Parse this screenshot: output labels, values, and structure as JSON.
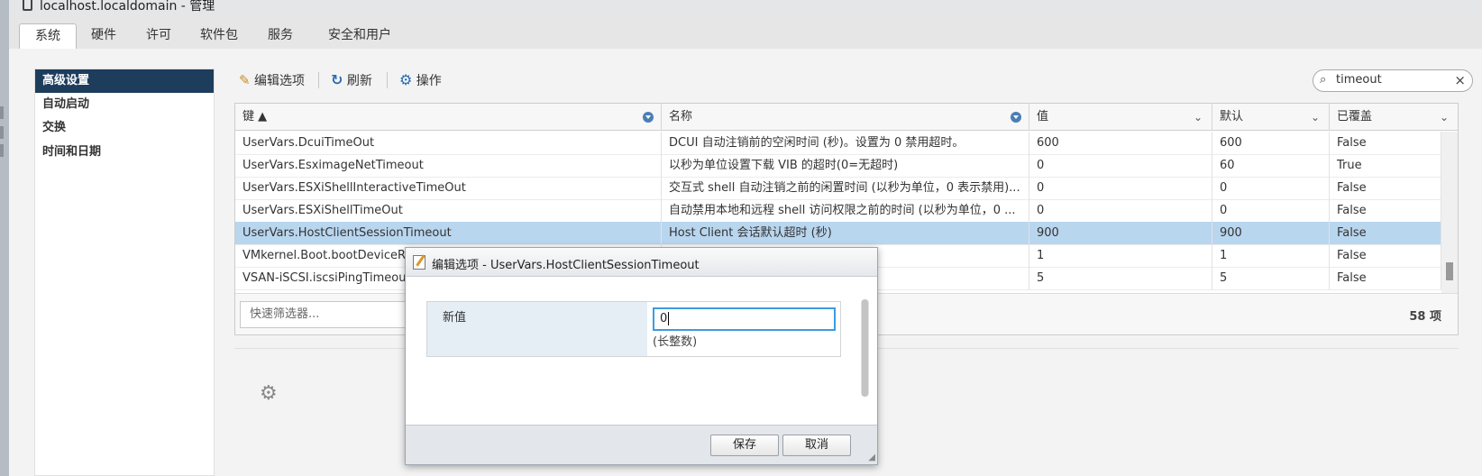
{
  "window": {
    "title": "localhost.localdomain - 管理"
  },
  "tabs": [
    {
      "label": "系统"
    },
    {
      "label": "硬件"
    },
    {
      "label": "许可"
    },
    {
      "label": "软件包"
    },
    {
      "label": "服务"
    },
    {
      "label": "安全和用户"
    }
  ],
  "sidebar": {
    "items": [
      {
        "label": "高级设置"
      },
      {
        "label": "自动启动"
      },
      {
        "label": "交换"
      },
      {
        "label": "时间和日期"
      }
    ]
  },
  "toolbar": {
    "edit_label": "编辑选项",
    "refresh_label": "刷新",
    "actions_label": "操作"
  },
  "search": {
    "value": "timeout"
  },
  "grid": {
    "headers": [
      "键 ▲",
      "名称",
      "值",
      "默认",
      "已覆盖"
    ],
    "rows": [
      [
        "UserVars.DcuiTimeOut",
        "DCUI 自动注销前的空闲时间 (秒)。设置为 0 禁用超时。",
        "600",
        "600",
        "False"
      ],
      [
        "UserVars.EsximageNetTimeout",
        "以秒为单位设置下载 VIB 的超时(0=无超时)",
        "0",
        "60",
        "True"
      ],
      [
        "UserVars.ESXiShellInteractiveTimeOut",
        "交互式 shell 自动注销之前的闲置时间 (以秒为单位，0 表示禁用)...",
        "0",
        "0",
        "False"
      ],
      [
        "UserVars.ESXiShellTimeOut",
        "自动禁用本地和远程 shell 访问权限之前的时间 (以秒为单位，0 ...",
        "0",
        "0",
        "False"
      ],
      [
        "UserVars.HostClientSessionTimeout",
        "Host Client 会话默认超时 (秒)",
        "900",
        "900",
        "False"
      ],
      [
        "VMkernel.Boot.bootDeviceRescanTimeout",
        "",
        "1",
        "1",
        "False"
      ],
      [
        "VSAN-iSCSI.iscsiPingTimeout",
        "?)",
        "5",
        "5",
        "False"
      ]
    ],
    "quick_filter_placeholder": "快速筛选器...",
    "item_count": "58 项"
  },
  "modal": {
    "title": "编辑选项 - UserVars.HostClientSessionTimeout",
    "field_label": "新值",
    "field_value": "0",
    "hint": "(长整数)",
    "save_label": "保存",
    "cancel_label": "取消"
  }
}
